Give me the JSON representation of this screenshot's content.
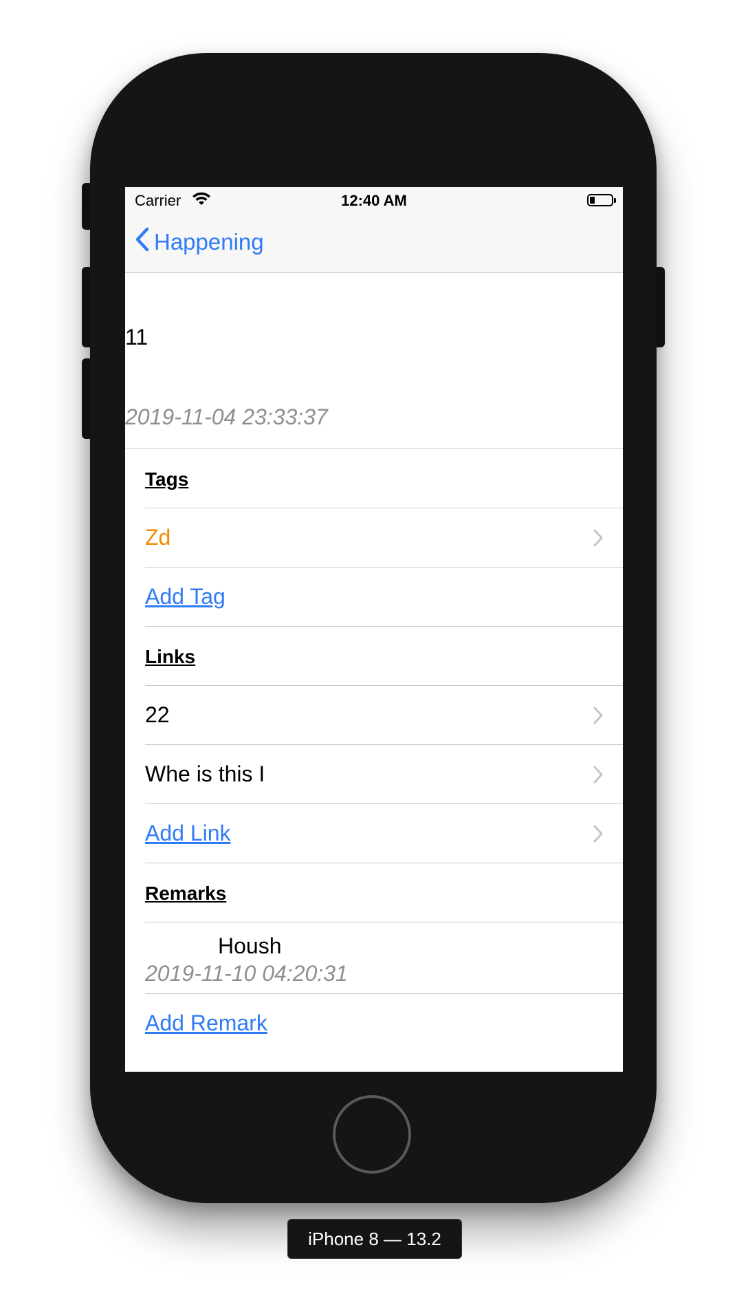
{
  "status_bar": {
    "carrier": "Carrier",
    "time": "12:40 AM"
  },
  "nav": {
    "back_label": "Happening"
  },
  "item": {
    "title": "11",
    "date": "2019-11-04 23:33:37"
  },
  "sections": {
    "tags_label": "Tags",
    "tags": [
      {
        "label": "Zd",
        "color": "#f18a00"
      }
    ],
    "add_tag": "Add Tag",
    "links_label": "Links",
    "links": [
      {
        "label": "22"
      },
      {
        "label": "Whe is this I"
      }
    ],
    "add_link": "Add Link",
    "remarks_label": "Remarks",
    "remarks": [
      {
        "text": "Housh",
        "date": "2019-11-10 04:20:31"
      }
    ],
    "add_remark": "Add Remark"
  },
  "device_label": "iPhone 8 — 13.2",
  "colors": {
    "accent": "#2f7bf6",
    "tag": "#f18a00",
    "secondary_text": "#8e8e93",
    "separator": "#c7c7cc"
  }
}
